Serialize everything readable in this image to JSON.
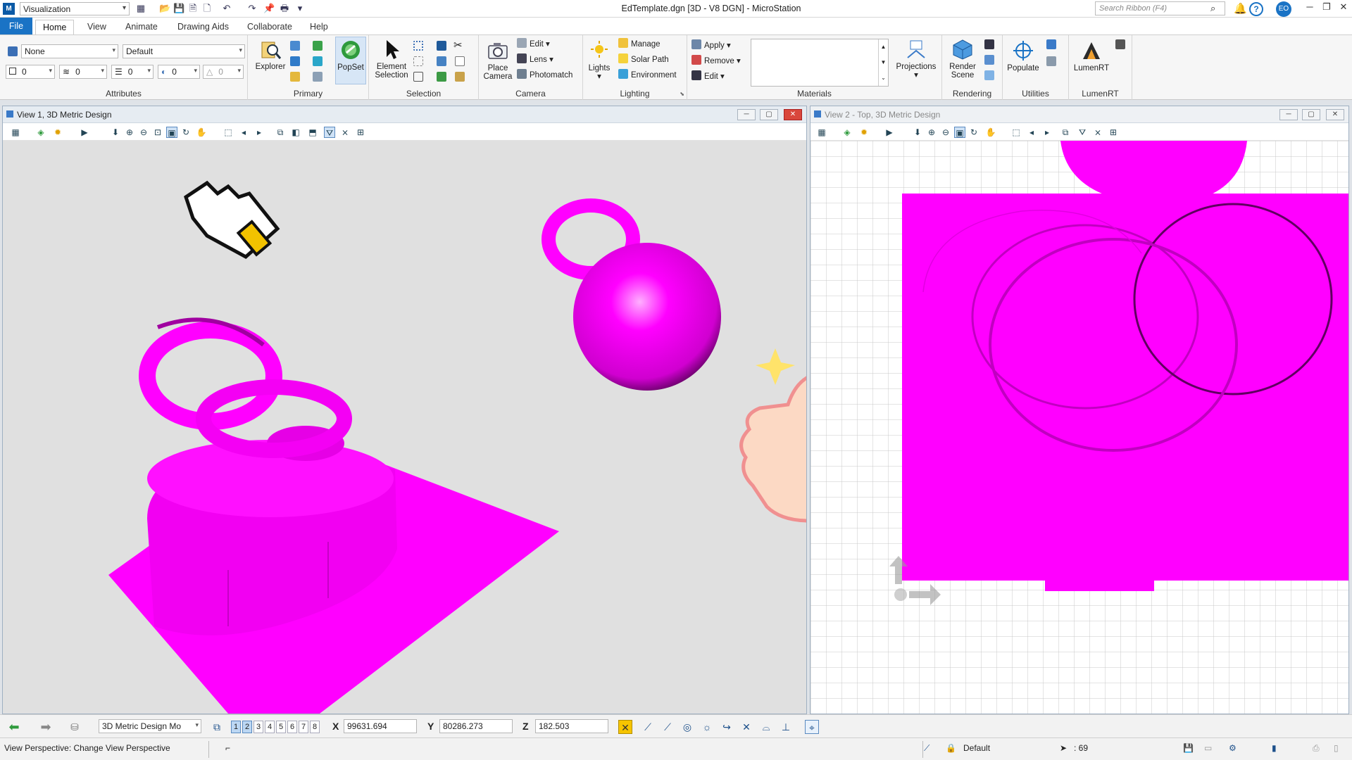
{
  "titlebar": {
    "workspace": "Visualization",
    "document_title": "EdTemplate.dgn [3D - V8 DGN] - MicroStation",
    "search_placeholder": "Search Ribbon (F4)",
    "user_initials": "EO"
  },
  "ribbon_tabs": [
    "File",
    "Home",
    "View",
    "Animate",
    "Drawing Aids",
    "Collaborate",
    "Help"
  ],
  "active_tab": "Home",
  "ribbon": {
    "attributes": {
      "label": "Attributes",
      "level": "None",
      "style": "Default",
      "color": "0",
      "linestyle": "0",
      "weight": "0",
      "transparency": "0",
      "priority": "0"
    },
    "primary": {
      "label": "Primary",
      "explorer": "Explorer",
      "popset": "PopSet"
    },
    "selection": {
      "label": "Selection",
      "element_selection_line1": "Element",
      "element_selection_line2": "Selection"
    },
    "camera": {
      "label": "Camera",
      "place_camera_line1": "Place",
      "place_camera_line2": "Camera",
      "edit": "Edit",
      "lens": "Lens",
      "photomatch": "Photomatch"
    },
    "lighting": {
      "label": "Lighting",
      "lights": "Lights",
      "manage": "Manage",
      "solar_path": "Solar Path",
      "environment": "Environment"
    },
    "materials": {
      "label": "Materials",
      "apply": "Apply",
      "remove": "Remove",
      "edit": "Edit",
      "projections": "Projections"
    },
    "rendering": {
      "label": "Rendering",
      "render_scene_line1": "Render",
      "render_scene_line2": "Scene"
    },
    "utilities": {
      "label": "Utilities",
      "populate": "Populate"
    },
    "lumenrt": {
      "label": "LumenRT",
      "button": "LumenRT"
    }
  },
  "view1": {
    "title": "View 1, 3D Metric Design"
  },
  "view2": {
    "title": "View 2 - Top, 3D Metric Design"
  },
  "bottom_toolbar": {
    "model": "3D Metric Design Mo",
    "view_numbers": [
      "1",
      "2",
      "3",
      "4",
      "5",
      "6",
      "7",
      "8"
    ],
    "x_label": "X",
    "x_value": "99631.694",
    "y_label": "Y",
    "y_value": "80286.273",
    "z_label": "Z",
    "z_value": "182.503"
  },
  "statusbar": {
    "message": "View Perspective: Change View Perspective",
    "level": "Default",
    "count": ": 69"
  },
  "colors": {
    "magenta": "#ff00ff",
    "accent": "#1a73c5",
    "viewport_bg": "#e0e0e0"
  }
}
